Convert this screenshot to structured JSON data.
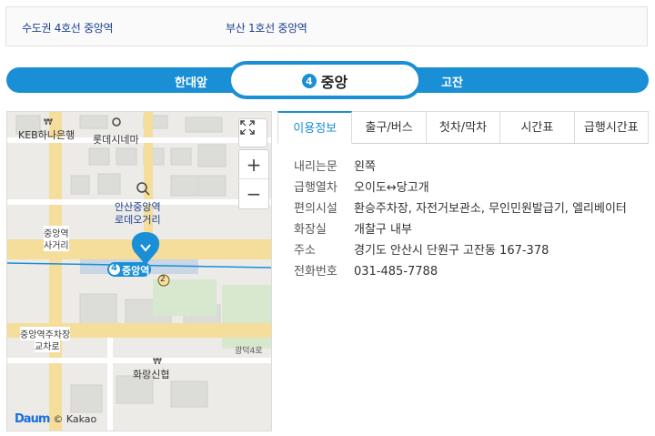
{
  "line_tabs": [
    "수도권 4호선 중앙역",
    "부산 1호선 중앙역"
  ],
  "navigator": {
    "prev": "한대앞",
    "current": "중앙",
    "line_number": "4",
    "next": "고잔"
  },
  "map": {
    "labels": {
      "keb": "KEB하나은행",
      "lotte": "롯데시네마",
      "ansan1": "안산중앙역",
      "ansan2": "로데오거리",
      "jungang_int1": "중앙역",
      "jungang_int2": "사거리",
      "station": "중앙역",
      "parking1": "중앙역주차장",
      "parking2": "교차로",
      "road": "광덕4로",
      "hwarang": "화랑신협",
      "line_badge": "4",
      "transfer_badge": "2"
    },
    "copyright": "© Kakao",
    "logo": "Daum",
    "zoom_in": "+",
    "zoom_out": "−",
    "colors": {
      "line4": "#1a8fd6",
      "road": "#f5dd9c"
    }
  },
  "info_tabs": [
    "이용정보",
    "출구/버스",
    "첫차/막차",
    "시간표",
    "급행시간표"
  ],
  "info": [
    {
      "label": "내리는문",
      "value": "왼쪽"
    },
    {
      "label": "급행열차",
      "value": "오이도↔당고개"
    },
    {
      "label": "편의시설",
      "value": "환승주차장, 자전거보관소, 무인민원발급기, 엘리베이터"
    },
    {
      "label": "화장실",
      "value": "개찰구 내부"
    },
    {
      "label": "주소",
      "value": "경기도 안산시 단원구 고잔동 167-378"
    },
    {
      "label": "전화번호",
      "value": "031-485-7788"
    }
  ]
}
